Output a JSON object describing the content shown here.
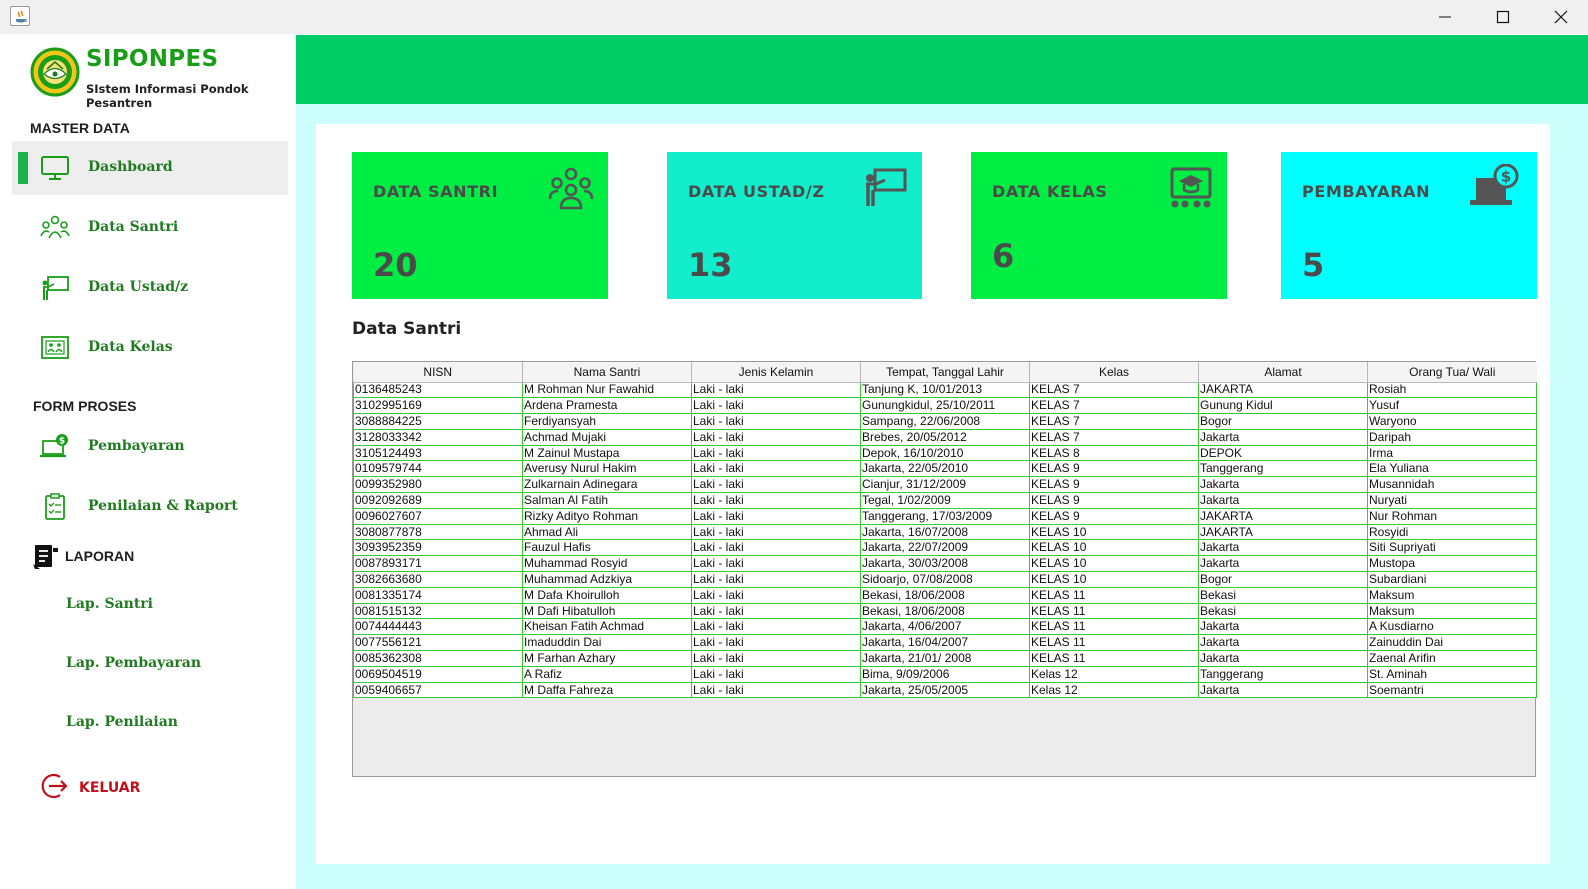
{
  "colors": {
    "brand_green": "#1a9e1a",
    "header_green": "#00cc66",
    "content_bg": "#ccfffb",
    "card_green": "#00ee44",
    "card_teal": "#12eecc",
    "card_cyan": "#00ffff",
    "grid_line": "#33cc33",
    "logout_red": "#c0111a"
  },
  "window": {
    "controls": [
      "minimize",
      "maximize",
      "close"
    ]
  },
  "sidebar": {
    "brand_title": "SIPONPES",
    "brand_subtitle": "SIstem Informasi Pondok Pesantren",
    "master_data_label": "MASTER DATA",
    "master_items": [
      {
        "label": "Dashboard",
        "icon": "monitor-icon",
        "active": true
      },
      {
        "label": "Data Santri",
        "icon": "group-icon"
      },
      {
        "label": "Data Ustad/z",
        "icon": "teacher-board-icon"
      },
      {
        "label": "Data Kelas",
        "icon": "class-board-icon"
      }
    ],
    "form_proses_label": "FORM PROSES",
    "form_items": [
      {
        "label": "Pembayaran",
        "icon": "payment-laptop-icon"
      },
      {
        "label": "Penilaian & Raport",
        "icon": "clipboard-icon"
      }
    ],
    "laporan_label": "LAPORAN",
    "laporan_items": [
      "Lap. Santri",
      "Lap. Pembayaran",
      "Lap. Penilaian"
    ],
    "logout_label": "KELUAR"
  },
  "cards": [
    {
      "title": "DATA SANTRI",
      "value": "20",
      "icon": "group-icon"
    },
    {
      "title": "DATA USTAD/Z",
      "value": "13",
      "icon": "teacher-board-icon"
    },
    {
      "title": "DATA KELAS",
      "value": "6",
      "icon": "class-board-icon"
    },
    {
      "title": "PEMBAYARAN",
      "value": "5",
      "icon": "payment-laptop-icon"
    }
  ],
  "table": {
    "title": "Data Santri",
    "columns": [
      "NISN",
      "Nama Santri",
      "Jenis Kelamin",
      "Tempat, Tanggal Lahir",
      "Kelas",
      "Alamat",
      "Orang Tua/ Wali"
    ],
    "rows": [
      [
        "0136485243",
        "M Rohman Nur Fawahid",
        "Laki - laki",
        "Tanjung K, 10/01/2013",
        "KELAS 7",
        "JAKARTA",
        "Rosiah"
      ],
      [
        "3102995169",
        "Ardena Pramesta",
        "Laki - laki",
        "Gunungkidul, 25/10/2011",
        "KELAS 7",
        "Gunung Kidul",
        "Yusuf"
      ],
      [
        "3088884225",
        "Ferdiyansyah",
        "Laki - laki",
        "Sampang, 22/06/2008",
        "KELAS 7",
        "Bogor",
        "Waryono"
      ],
      [
        "3128033342",
        "Achmad Mujaki",
        "Laki - laki",
        "Brebes, 20/05/2012",
        "KELAS 7",
        "Jakarta",
        "Daripah"
      ],
      [
        "3105124493",
        "M Zainul Mustapa",
        "Laki - laki",
        "Depok, 16/10/2010",
        "KELAS 8",
        "DEPOK",
        "Irma"
      ],
      [
        "0109579744",
        "Averusy Nurul Hakim",
        "Laki - laki",
        "Jakarta, 22/05/2010",
        "KELAS 9",
        "Tanggerang",
        "Ela Yuliana"
      ],
      [
        "0099352980",
        "Zulkarnain Adinegara",
        "Laki - laki",
        "Cianjur, 31/12/2009",
        "KELAS 9",
        "Jakarta",
        "Musannidah"
      ],
      [
        "0092092689",
        "Salman Al Fatih",
        "Laki - laki",
        "Tegal, 1/02/2009",
        "KELAS 9",
        "Jakarta",
        "Nuryati"
      ],
      [
        "0096027607",
        "Rizky Adityo Rohman",
        "Laki - laki",
        "Tanggerang, 17/03/2009",
        "KELAS 9",
        "JAKARTA",
        "Nur Rohman"
      ],
      [
        "3080877878",
        "Ahmad Ali",
        "Laki - laki",
        "Jakarta, 16/07/2008",
        "KELAS 10",
        "JAKARTA",
        "Rosyidi"
      ],
      [
        "3093952359",
        "Fauzul Hafis",
        "Laki - laki",
        "Jakarta, 22/07/2009",
        "KELAS 10",
        "Jakarta",
        "Siti Supriyati"
      ],
      [
        "0087893171",
        "Muhammad Rosyid",
        "Laki - laki",
        "Jakarta, 30/03/2008",
        "KELAS 10",
        "Jakarta",
        "Mustopa"
      ],
      [
        "3082663680",
        "Muhammad Adzkiya",
        "Laki - laki",
        "Sidoarjo, 07/08/2008",
        "KELAS 10",
        "Bogor",
        "Subardiani"
      ],
      [
        "0081335174",
        "M Dafa Khoirulloh",
        "Laki - laki",
        "Bekasi, 18/06/2008",
        "KELAS 11",
        "Bekasi",
        "Maksum"
      ],
      [
        "0081515132",
        "M Dafi Hibatulloh",
        "Laki - laki",
        "Bekasi, 18/06/2008",
        "KELAS 11",
        "Bekasi",
        "Maksum"
      ],
      [
        "0074444443",
        "Kheisan Fatih Achmad",
        "Laki - laki",
        "Jakarta, 4/06/2007",
        "KELAS 11",
        "Jakarta",
        "A Kusdiarno"
      ],
      [
        "0077556121",
        "Imaduddin Dai",
        "Laki - laki",
        "Jakarta, 16/04/2007",
        "KELAS 11",
        "Jakarta",
        "Zainuddin Dai"
      ],
      [
        "0085362308",
        "M Farhan Azhary",
        "Laki - laki",
        "Jakarta, 21/01/ 2008",
        "KELAS 11",
        "Jakarta",
        "Zaenal Arifin"
      ],
      [
        "0069504519",
        "A Rafiz",
        "Laki - laki",
        "Bima, 9/09/2006",
        "Kelas 12",
        "Tanggerang",
        "St. Aminah"
      ],
      [
        "0059406657",
        "M Daffa Fahreza",
        "Laki - laki",
        "Jakarta, 25/05/2005",
        "Kelas 12",
        "Jakarta",
        "Soemantri"
      ]
    ]
  }
}
